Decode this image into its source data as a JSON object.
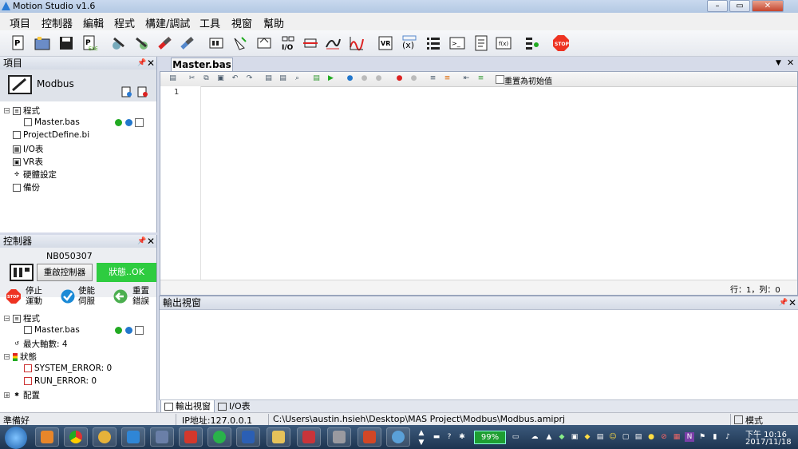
{
  "app": {
    "title": "Motion Studio  v1.6"
  },
  "menu": [
    "項目",
    "控制器",
    "編輯",
    "程式",
    "構建/調試",
    "工具",
    "視窗",
    "幫助"
  ],
  "toolbar": {
    "icons": [
      "new-project-icon",
      "open-project-icon",
      "save-icon",
      "build-exe-icon",
      "connect-icon",
      "disconnect-icon",
      "link-icon",
      "unlink-icon",
      "controller-icon",
      "download-icon",
      "upload-icon",
      "io-icon",
      "axis-icon",
      "scope-icon",
      "wave-icon",
      "vr-icon",
      "variable-icon",
      "list-icon",
      "terminal-icon",
      "report-icon",
      "function-icon",
      "settings-icon",
      "stop-icon"
    ],
    "stop_label": "STOP"
  },
  "project_panel": {
    "title": "項目",
    "project_name": "Modbus",
    "tree": [
      {
        "label": "程式",
        "expander": "⊟"
      },
      {
        "label": "Master.bas"
      },
      {
        "label": "ProjectDefine.bi"
      },
      {
        "label": "I/O表"
      },
      {
        "label": "VR表"
      },
      {
        "label": "硬體設定"
      },
      {
        "label": "備份"
      }
    ]
  },
  "controller_panel": {
    "title": "控制器",
    "serial": "NB050307",
    "restart_label": "重啟控制器",
    "status_label": "狀態..OK",
    "status_color": "#2ecc40",
    "actions": [
      {
        "l1": "停止",
        "l2": "運動",
        "icon": "stop-icon"
      },
      {
        "l1": "使能",
        "l2": "伺服",
        "icon": "enable-servo-icon"
      },
      {
        "l1": "重置",
        "l2": "錯誤",
        "icon": "reset-error-icon"
      }
    ],
    "stop_badge": "STOP",
    "tree": [
      {
        "label": "程式"
      },
      {
        "label": "Master.bas"
      },
      {
        "label": "最大軸數: 4"
      },
      {
        "label": "狀態"
      },
      {
        "label": "SYSTEM_ERROR: 0"
      },
      {
        "label": "RUN_ERROR: 0"
      },
      {
        "label": "配置"
      }
    ]
  },
  "editor": {
    "tab": "Master.bas",
    "line_number": "1",
    "reset_label": "重置為初始值",
    "cursor_pos": "行：1，列：0"
  },
  "output": {
    "title": "輸出視窗",
    "tabs": [
      "輸出視窗",
      "I/O表"
    ]
  },
  "statusbar": {
    "ready": "準備好",
    "ip": "IP地址:127.0.0.1",
    "path": "C:\\Users\\austin.hsieh\\Desktop\\MAS Project\\Modbus\\Modbus.amiprj",
    "mode": "模式"
  },
  "taskbar": {
    "battery": "99%",
    "time": "下午 10:16",
    "date": "2017/11/18"
  }
}
